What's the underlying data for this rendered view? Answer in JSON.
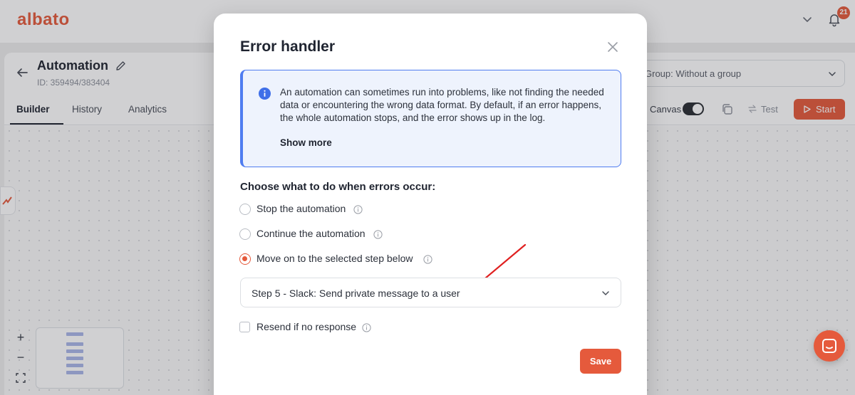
{
  "header": {
    "logo": "albato",
    "notifications_count": "21"
  },
  "automation": {
    "title": "Automation",
    "id": "ID: 359494/383404",
    "tabs": [
      {
        "label": "Builder",
        "active": true
      },
      {
        "label": "History",
        "active": false
      },
      {
        "label": "Analytics",
        "active": false
      }
    ],
    "group_select": "Group: Without a group",
    "canvas_label": "Canvas",
    "canvas_toggle_on": true,
    "test_label": "Test",
    "start_label": "Start"
  },
  "canvas": {
    "zoom_in": "+",
    "zoom_out": "−"
  },
  "modal": {
    "title": "Error handler",
    "info_text": "An automation can sometimes run into problems, like not finding the needed data or encountering the wrong data format. By default, if an error happens, the whole automation stops, and the error shows up in the log.",
    "show_more": "Show more",
    "choose_title": "Choose what to do when errors occur:",
    "options": [
      {
        "label": "Stop the automation",
        "checked": false
      },
      {
        "label": "Continue the automation",
        "checked": false
      },
      {
        "label": "Move on to the selected step below",
        "checked": true
      }
    ],
    "step_select": "Step 5 - Slack: Send private message to a user",
    "resend_label": "Resend if no response",
    "resend_checked": false,
    "save_label": "Save"
  },
  "colors": {
    "accent": "#e55a3c",
    "info_border": "#4f7cf0",
    "info_bg": "#eef3fd",
    "annotation_arrow": "#e02020"
  }
}
